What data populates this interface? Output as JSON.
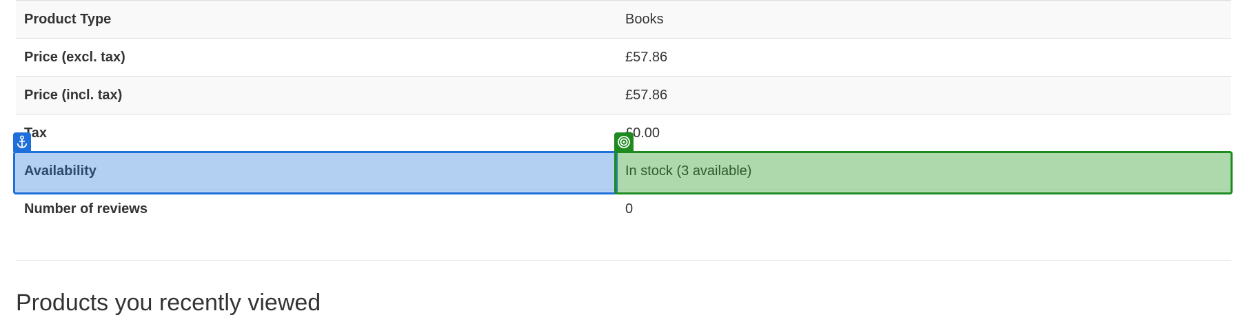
{
  "product_info": {
    "rows": [
      {
        "label": "Product Type",
        "value": "Books"
      },
      {
        "label": "Price (excl. tax)",
        "value": "£57.86"
      },
      {
        "label": "Price (incl. tax)",
        "value": "£57.86"
      },
      {
        "label": "Tax",
        "value": "£0.00"
      },
      {
        "label": "Availability",
        "value": "In stock (3 available)"
      },
      {
        "label": "Number of reviews",
        "value": "0"
      }
    ]
  },
  "recently_viewed": {
    "heading": "Products you recently viewed"
  },
  "overlays": {
    "anchor_icon": "anchor-icon",
    "target_icon": "target-icon",
    "anchor_color": "#1e6fd9",
    "target_color": "#1f8a1f"
  }
}
